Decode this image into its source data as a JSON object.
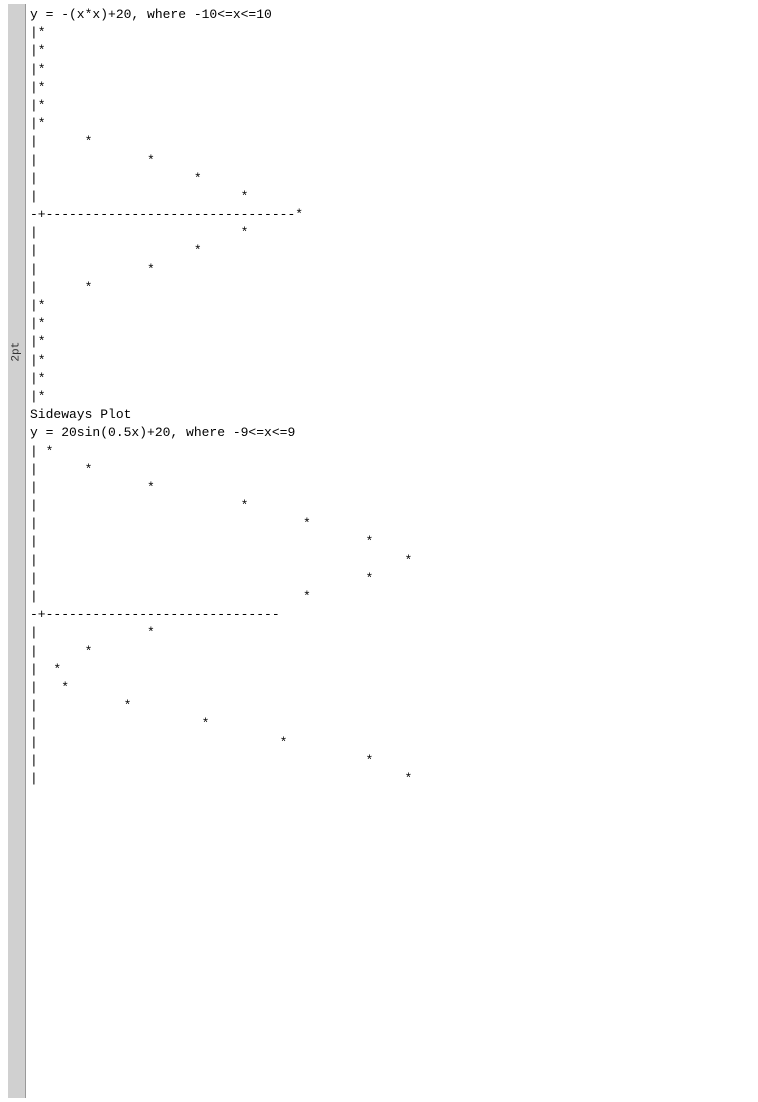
{
  "plots": {
    "plot1": {
      "title": "y = -(x*x)+20, where -10<=x<=10",
      "lines": [
        "|*",
        "|*",
        "|*",
        "|*",
        "|*",
        "|*",
        "|      *",
        "|              *",
        "|                    *",
        "|                          *",
        "-+--------------------------------*",
        "|                          *",
        "|                    *",
        "|              *",
        "|      *",
        "|*",
        "|*",
        "|*",
        "|*",
        "|*",
        "|*"
      ]
    },
    "sideways_label": "Sideways Plot",
    "plot2": {
      "title": "y = 20sin(0.5x)+20, where -9<=x<=9",
      "lines": [
        "| *",
        "|      *",
        "|              *",
        "|                          *",
        "|                                  *",
        "|                                          *",
        "|                                               *",
        "|                                          *",
        "|                                  *",
        "-+------------------------------",
        "|              *",
        "|      *",
        "|  *",
        "|   *",
        "|           *",
        "|                     *",
        "|                               *",
        "|                                          *",
        "|                                               *"
      ]
    }
  },
  "sidebar": {
    "label": "2pt"
  }
}
